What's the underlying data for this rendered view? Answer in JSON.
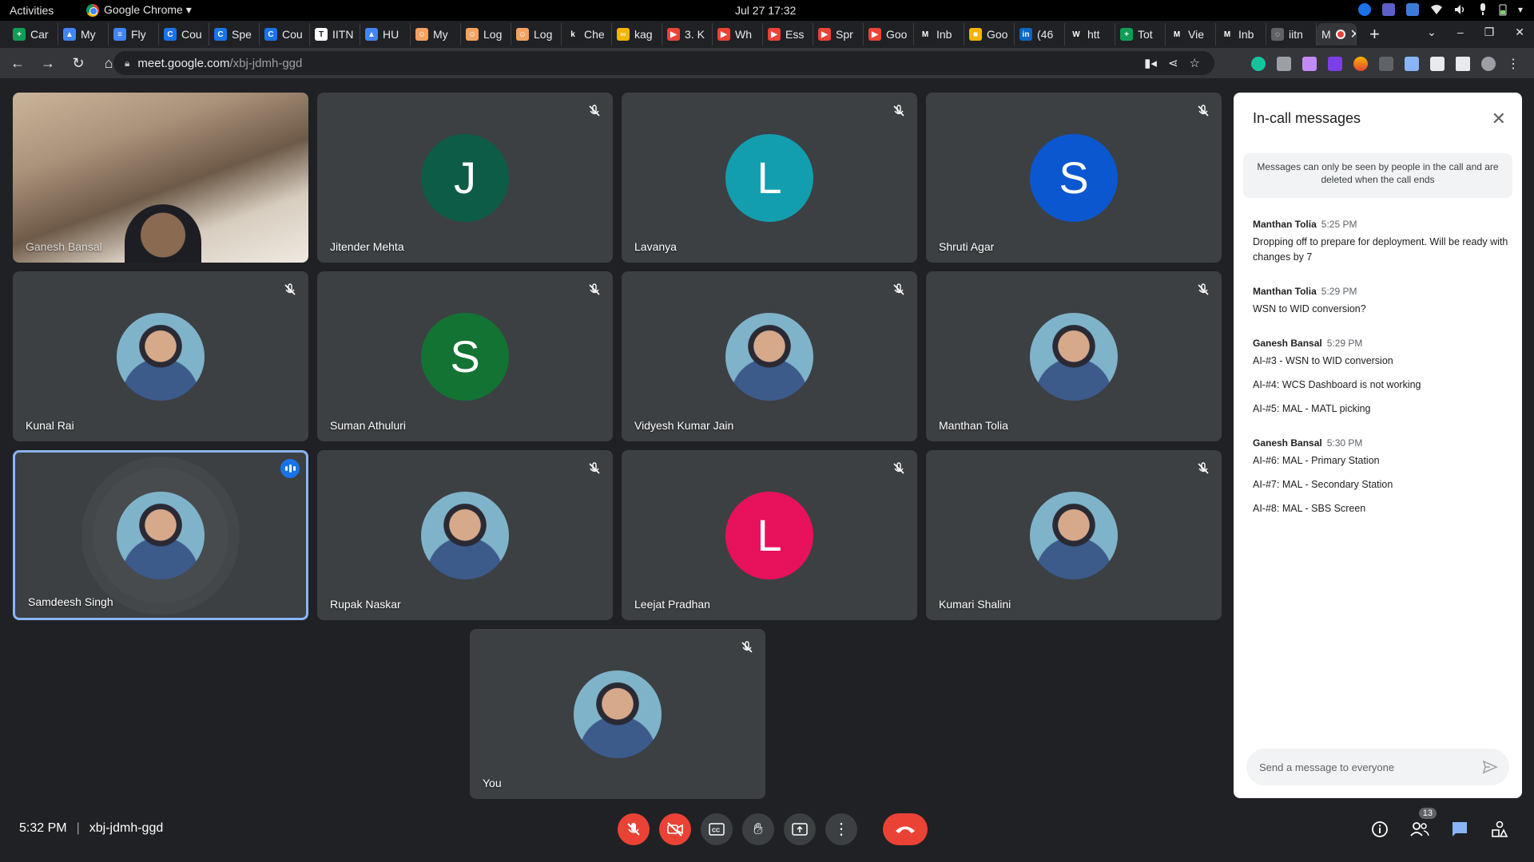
{
  "system_bar": {
    "activities": "Activities",
    "app_name": "Google Chrome ▾",
    "clock": "Jul 27  17:32"
  },
  "browser": {
    "tabs": [
      {
        "label": "Car",
        "color": "#0f9d58",
        "glyph": "+"
      },
      {
        "label": "My",
        "color": "#4285f4",
        "glyph": "▲"
      },
      {
        "label": "Fly",
        "color": "#4285f4",
        "glyph": "≡"
      },
      {
        "label": "Cou",
        "color": "#1a73e8",
        "glyph": "C"
      },
      {
        "label": "Spe",
        "color": "#1a73e8",
        "glyph": "C"
      },
      {
        "label": "Cou",
        "color": "#1a73e8",
        "glyph": "C"
      },
      {
        "label": "IITN",
        "color": "#fff",
        "glyph": "T"
      },
      {
        "label": "HU",
        "color": "#4285f4",
        "glyph": "▲"
      },
      {
        "label": "My",
        "color": "#f4a261",
        "glyph": "☺"
      },
      {
        "label": "Log",
        "color": "#f4a261",
        "glyph": "☺"
      },
      {
        "label": "Log",
        "color": "#f4a261",
        "glyph": "☺"
      },
      {
        "label": "Che",
        "color": "#202124",
        "glyph": "k"
      },
      {
        "label": "kag",
        "color": "#f4b400",
        "glyph": "∞"
      },
      {
        "label": "3. K",
        "color": "#ea4335",
        "glyph": "▶"
      },
      {
        "label": "Wh",
        "color": "#ea4335",
        "glyph": "▶"
      },
      {
        "label": "Ess",
        "color": "#ea4335",
        "glyph": "▶"
      },
      {
        "label": "Spr",
        "color": "#ea4335",
        "glyph": "▶"
      },
      {
        "label": "Goo",
        "color": "#ea4335",
        "glyph": "▶"
      },
      {
        "label": "Inb",
        "color": "#202124",
        "glyph": "M"
      },
      {
        "label": "Goo",
        "color": "#f4b400",
        "glyph": "■"
      },
      {
        "label": "(46",
        "color": "#0a66c2",
        "glyph": "in"
      },
      {
        "label": "htt",
        "color": "#202124",
        "glyph": "W"
      },
      {
        "label": "Tot",
        "color": "#0f9d58",
        "glyph": "+"
      },
      {
        "label": "Vie",
        "color": "#202124",
        "glyph": "M"
      },
      {
        "label": "Inb",
        "color": "#202124",
        "glyph": "M"
      },
      {
        "label": "iitn",
        "color": "#5f6368",
        "glyph": "◌"
      },
      {
        "label": "M",
        "color": "#35363a",
        "glyph": ""
      }
    ],
    "new_tab": "+",
    "url_host": "meet.google.com",
    "url_path": "/xbj-jdmh-ggd"
  },
  "meeting": {
    "participants": [
      {
        "name": "Ganesh Bansal",
        "type": "video"
      },
      {
        "name": "Jitender Mehta",
        "type": "letter",
        "letter": "J",
        "color": "#0d5c47"
      },
      {
        "name": "Lavanya",
        "type": "letter",
        "letter": "L",
        "color": "#129eaf"
      },
      {
        "name": "Shruti Agar",
        "type": "letter",
        "letter": "S",
        "color": "#0b57d0"
      },
      {
        "name": "Kunal Rai",
        "type": "photo"
      },
      {
        "name": "Suman Athuluri",
        "type": "letter",
        "letter": "S",
        "color": "#137333"
      },
      {
        "name": "Vidyesh Kumar Jain",
        "type": "photo"
      },
      {
        "name": "Manthan Tolia",
        "type": "photo"
      },
      {
        "name": "Samdeesh Singh",
        "type": "photo",
        "speaking": true
      },
      {
        "name": "Rupak Naskar",
        "type": "photo"
      },
      {
        "name": "Leejat Pradhan",
        "type": "letter",
        "letter": "L",
        "color": "#e8115b"
      },
      {
        "name": "Kumari Shalini",
        "type": "photo"
      },
      {
        "name": "You",
        "type": "photo"
      }
    ],
    "time": "5:32 PM",
    "separator": "|",
    "meeting_code": "xbj-jdmh-ggd",
    "people_count": "13"
  },
  "chat": {
    "title": "In-call messages",
    "notice": "Messages can only be seen by people in the call and are deleted when the call ends",
    "messages": [
      {
        "sender": "Manthan Tolia",
        "time": "5:25 PM",
        "lines": [
          "Dropping off to prepare for deployment. Will be ready with changes by 7"
        ]
      },
      {
        "sender": "Manthan Tolia",
        "time": "5:29 PM",
        "lines": [
          "WSN to WID conversion?"
        ]
      },
      {
        "sender": "Ganesh Bansal",
        "time": "5:29 PM",
        "lines": [
          "AI-#3 - WSN to WID conversion",
          "AI-#4: WCS Dashboard is not working",
          "AI-#5: MAL - MATL picking"
        ]
      },
      {
        "sender": "Ganesh Bansal",
        "time": "5:30 PM",
        "lines": [
          "AI-#6: MAL - Primary Station",
          "AI-#7: MAL - Secondary Station",
          "AI-#8: MAL - SBS Screen"
        ]
      }
    ],
    "input_placeholder": "Send a message to everyone"
  }
}
